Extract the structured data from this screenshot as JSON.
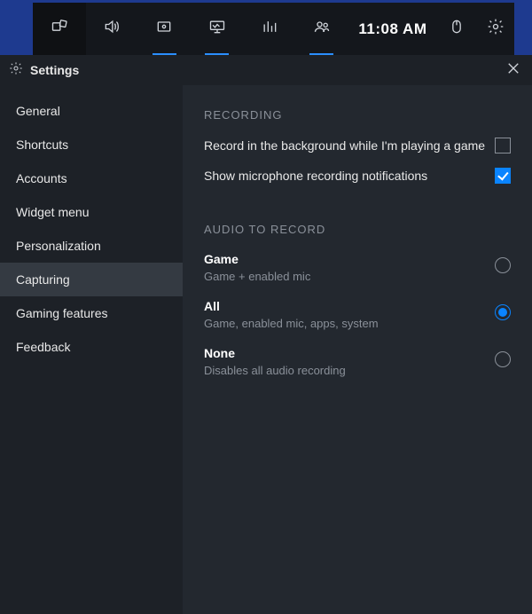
{
  "topbar": {
    "clock": "11:08 AM"
  },
  "window": {
    "title": "Settings"
  },
  "sidebar": {
    "items": [
      {
        "label": "General"
      },
      {
        "label": "Shortcuts"
      },
      {
        "label": "Accounts"
      },
      {
        "label": "Widget menu"
      },
      {
        "label": "Personalization"
      },
      {
        "label": "Capturing"
      },
      {
        "label": "Gaming features"
      },
      {
        "label": "Feedback"
      }
    ],
    "active_index": 5
  },
  "content": {
    "recording": {
      "section_label": "RECORDING",
      "background_label": "Record in the background while I'm playing a game",
      "background_checked": false,
      "mic_label": "Show microphone recording notifications",
      "mic_checked": true
    },
    "audio": {
      "section_label": "AUDIO TO RECORD",
      "options": [
        {
          "title": "Game",
          "desc": "Game + enabled mic",
          "selected": false
        },
        {
          "title": "All",
          "desc": "Game, enabled mic, apps, system",
          "selected": true
        },
        {
          "title": "None",
          "desc": "Disables all audio recording",
          "selected": false
        }
      ]
    }
  }
}
